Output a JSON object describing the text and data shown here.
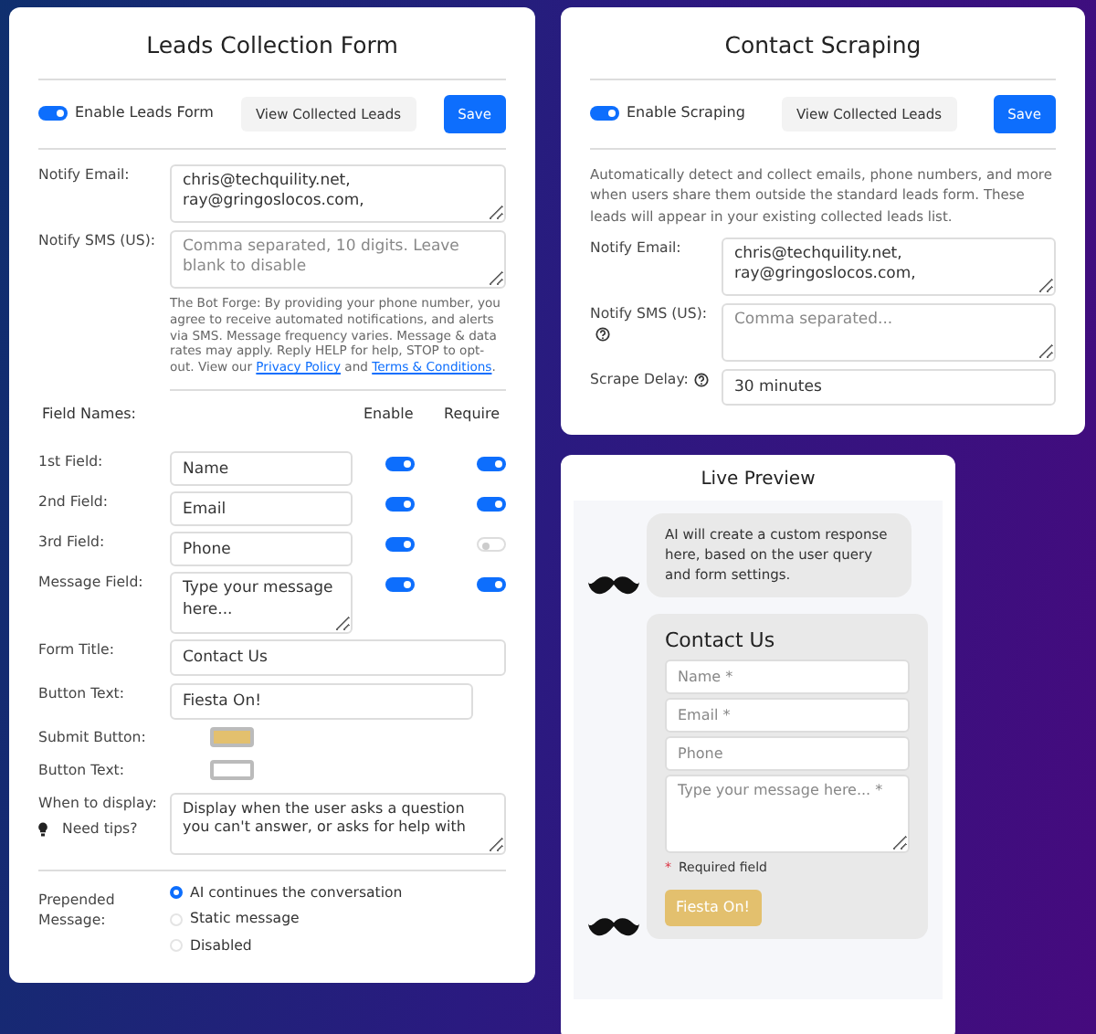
{
  "leads_form": {
    "title": "Leads Collection Form",
    "enable_toggle": {
      "label": "Enable Leads Form",
      "on": true
    },
    "view_button": "View Collected Leads",
    "save_button": "Save",
    "notify_email": {
      "label": "Notify Email:",
      "value": "chris@techquility.net,\nray@gringoslocos.com,"
    },
    "notify_sms": {
      "label": "Notify SMS (US):",
      "placeholder": "Comma separated, 10 digits. Leave blank to disable"
    },
    "disclaimer": {
      "text": "The Bot Forge: By providing your phone number, you agree to receive automated notifications, and alerts via SMS. Message frequency varies. Message & data rates may apply. Reply HELP for help, STOP to opt-out. View our",
      "link_1": "Privacy Policy",
      "joiner": "and",
      "link_2": "Terms & Conditions",
      "end": "."
    },
    "fields_header": {
      "names": "Field Names:",
      "enable": "Enable",
      "require": "Require"
    },
    "fields": [
      {
        "label": "1st Field:",
        "kind": "input",
        "value": "Name",
        "enabled": true,
        "required": true
      },
      {
        "label": "2nd Field:",
        "kind": "input",
        "value": "Email",
        "enabled": true,
        "required": true
      },
      {
        "label": "3rd Field:",
        "kind": "input",
        "value": "Phone",
        "enabled": true,
        "required": false
      },
      {
        "label": "Message Field:",
        "kind": "textarea",
        "value": "Type your message here...",
        "enabled": true,
        "required": true
      }
    ],
    "form_title": {
      "label": "Form Title:",
      "value": "Contact Us"
    },
    "button_text": {
      "label": "Button Text:",
      "value": "Fiesta On!"
    },
    "submit_button_color": {
      "label": "Submit Button:",
      "color": "#e3c06e"
    },
    "button_text_color": {
      "label": "Button Text:",
      "color": "#ffffff"
    },
    "when_to_display": {
      "label": "When to display:",
      "value": "Display when the user asks a question you can't answer, or asks for help with"
    },
    "tips": "Need tips?",
    "prepended": {
      "label": "Prepended Message:",
      "options": [
        {
          "label": "AI continues the conversation",
          "selected": true
        },
        {
          "label": "Static message",
          "selected": false
        },
        {
          "label": "Disabled",
          "selected": false
        }
      ]
    }
  },
  "scraping": {
    "title": "Contact Scraping",
    "enable_toggle": {
      "label": "Enable Scraping",
      "on": true
    },
    "view_button": "View Collected Leads",
    "save_button": "Save",
    "description": "Automatically detect and collect emails, phone numbers, and more when users share them outside the standard leads form. These leads will appear in your existing collected leads list.",
    "notify_email": {
      "label": "Notify Email:",
      "value": "chris@techquility.net,\nray@gringoslocos.com,"
    },
    "notify_sms": {
      "label": "Notify SMS (US):",
      "placeholder": "Comma separated..."
    },
    "scrape_delay": {
      "label": "Scrape Delay:",
      "value": "30 minutes"
    }
  },
  "preview": {
    "title": "Live Preview",
    "bubble": "AI will create a custom response here, based on the user query and form settings.",
    "form": {
      "title": "Contact Us",
      "fields": [
        {
          "kind": "input",
          "placeholder": "Name *"
        },
        {
          "kind": "input",
          "placeholder": "Email *"
        },
        {
          "kind": "input",
          "placeholder": "Phone"
        },
        {
          "kind": "textarea",
          "placeholder": "Type your message here... *"
        }
      ],
      "required_mark": "*",
      "required_note": "Required field",
      "button": "Fiesta On!"
    }
  }
}
